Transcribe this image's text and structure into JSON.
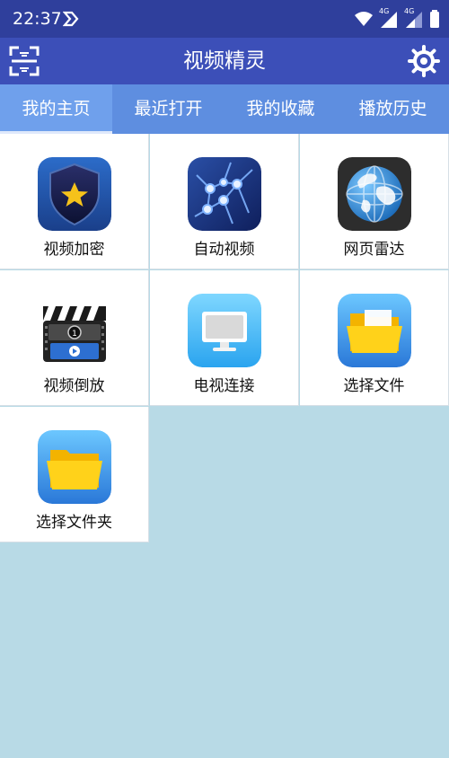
{
  "status": {
    "time": "22:37",
    "net1": "4G",
    "net2": "4G"
  },
  "app": {
    "title": "视频精灵"
  },
  "tabs": [
    {
      "label": "我的主页",
      "active": true
    },
    {
      "label": "最近打开",
      "active": false
    },
    {
      "label": "我的收藏",
      "active": false
    },
    {
      "label": "播放历史",
      "active": false
    }
  ],
  "grid": [
    {
      "label": "视频加密",
      "icon": "shield-star-icon"
    },
    {
      "label": "自动视频",
      "icon": "network-graph-icon"
    },
    {
      "label": "网页雷达",
      "icon": "globe-icon"
    },
    {
      "label": "视频倒放",
      "icon": "film-clapper-icon"
    },
    {
      "label": "电视连接",
      "icon": "monitor-icon"
    },
    {
      "label": "选择文件",
      "icon": "folder-icon"
    },
    {
      "label": "选择文件夹",
      "icon": "folder-icon"
    }
  ],
  "colors": {
    "statusBar": "#2f3f9c",
    "appBar": "#3c4fb8",
    "tabs": "#5e8ee0",
    "background": "#b8dae6"
  }
}
